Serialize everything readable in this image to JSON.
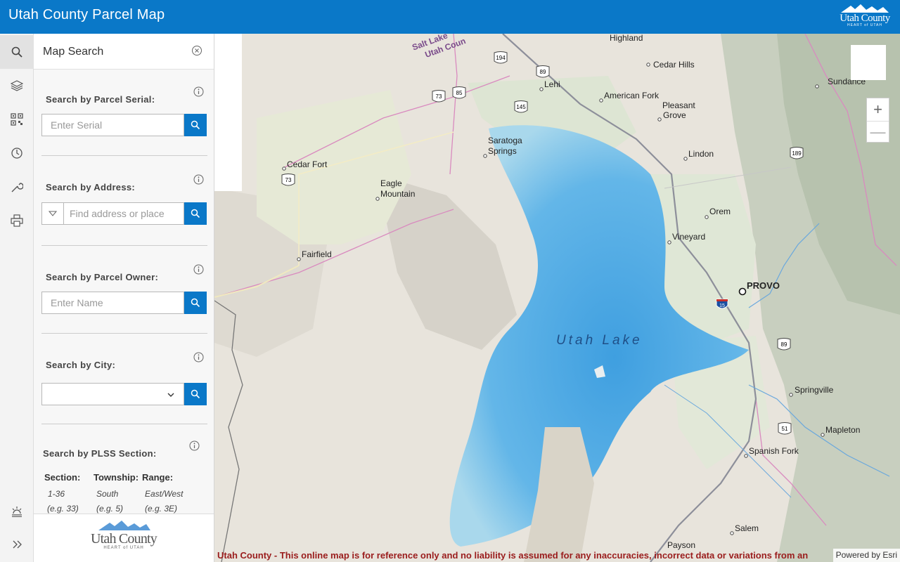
{
  "header": {
    "title": "Utah County Parcel Map",
    "logo_text": "Utah County",
    "logo_sub": "HEART of UTAH"
  },
  "rail": {
    "items": [
      "search-icon",
      "layers-icon",
      "qr-grid-icon",
      "history-icon",
      "wrench-icon",
      "print-icon"
    ],
    "bottom": [
      "light-icon",
      "expand-icon"
    ]
  },
  "panel": {
    "title": "Map Search",
    "parcel_serial": {
      "label": "Search by Parcel Serial:",
      "placeholder": "Enter Serial"
    },
    "address": {
      "label": "Search by Address:",
      "placeholder": "Find address or place"
    },
    "owner": {
      "label": "Search by Parcel Owner:",
      "placeholder": "Enter Name"
    },
    "city": {
      "label": "Search by City:",
      "value": ""
    },
    "plss": {
      "label": "Search by PLSS Section:",
      "columns": [
        "Section:",
        "Township:",
        "Range:"
      ],
      "hints_line1": [
        "1-36",
        "South",
        "East/West"
      ],
      "hints_line2": [
        "(e.g. 33)",
        "(e.g. 5)",
        "(e.g. 3E)"
      ]
    },
    "footer_logo_text": "Utah County",
    "footer_logo_sub": "HEART of UTAH"
  },
  "map": {
    "lake_label": "Utah Lake",
    "places": {
      "highland": "Highland",
      "cedar_hills": "Cedar Hills",
      "lehi": "Lehi",
      "american_fork": "American Fork",
      "pleasant_grove_1": "Pleasant",
      "pleasant_grove_2": "Grove",
      "sundance": "Sundance",
      "saratoga_1": "Saratoga",
      "saratoga_2": "Springs",
      "cedar_fort": "Cedar Fort",
      "eagle_mountain_1": "Eagle",
      "eagle_mountain_2": "Mountain",
      "lindon": "Lindon",
      "orem": "Orem",
      "vineyard": "Vineyard",
      "fairfield": "Fairfield",
      "provo": "PROVO",
      "springville": "Springville",
      "mapleton": "Mapleton",
      "spanish_fork": "Spanish Fork",
      "salem": "Salem",
      "payson": "Payson",
      "salt_lake_1": "Salt Lake",
      "salt_lake_2": "Utah Coun"
    },
    "shields": [
      "194",
      "89",
      "73",
      "85",
      "145",
      "73",
      "189",
      "15",
      "89",
      "51"
    ],
    "zoom_in": "+",
    "zoom_out": "—",
    "disclaimer": "Utah County - This online map is for reference only and no liability is assumed for any inaccuracies, incorrect data or variations from an",
    "powered_by": "Powered by Esri"
  }
}
